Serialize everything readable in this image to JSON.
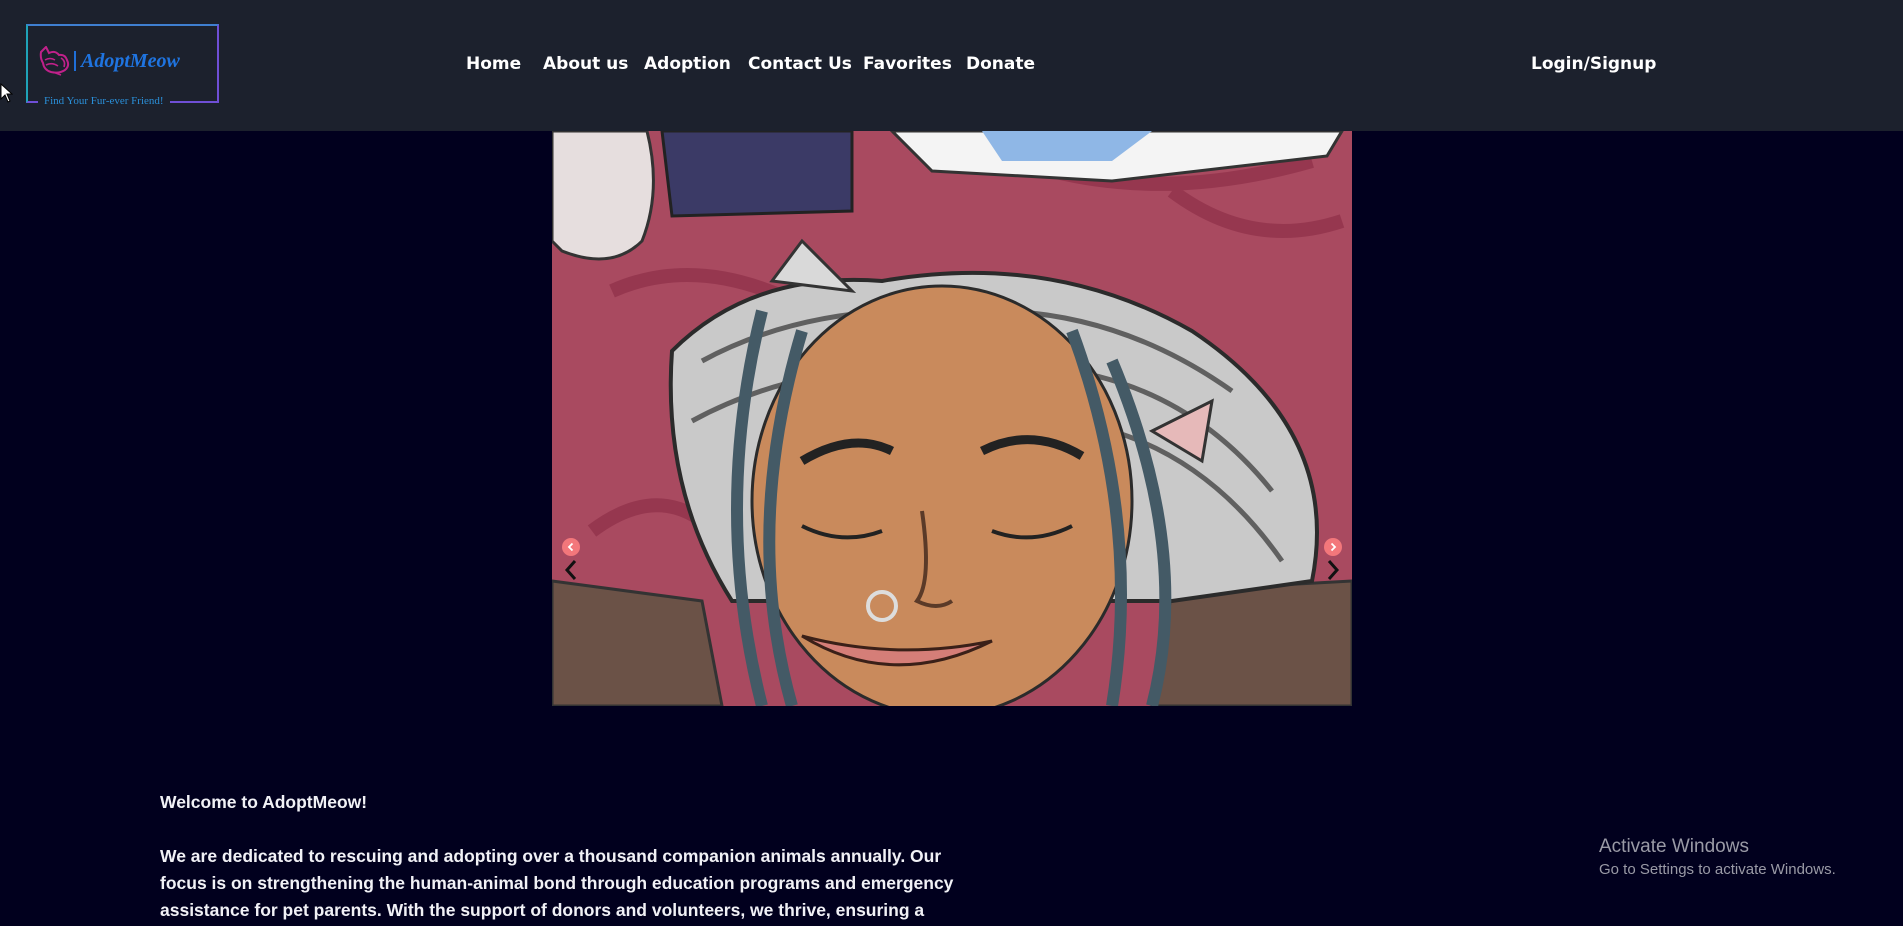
{
  "header": {
    "logo": {
      "name": "AdoptMeow",
      "tagline": "Find Your Fur-ever Friend!"
    },
    "nav": [
      {
        "label": "Home"
      },
      {
        "label": "About us"
      },
      {
        "label": "Adoption"
      },
      {
        "label": "Contact Us"
      },
      {
        "label": "Favorites"
      },
      {
        "label": "Donate"
      }
    ],
    "login_label": "Login/Signup"
  },
  "carousel": {
    "prev_icon": "chevron-left-icon",
    "next_icon": "chevron-right-icon"
  },
  "intro": {
    "heading": "Welcome to AdoptMeow!",
    "paragraph": "We are dedicated to rescuing and adopting over a thousand companion animals annually. Our focus is on strengthening the human-animal bond through education programs and emergency assistance for pet parents. With the support of donors and volunteers, we thrive, ensuring a"
  },
  "watermark": {
    "title": "Activate Windows",
    "subtitle": "Go to Settings to activate Windows."
  },
  "colors": {
    "navbar_bg": "#1c212d",
    "page_bg": "#01001e",
    "logo_blue": "#1f74e0",
    "logo_purple": "#6f4fd6",
    "carousel_dot": "#f3777b"
  }
}
